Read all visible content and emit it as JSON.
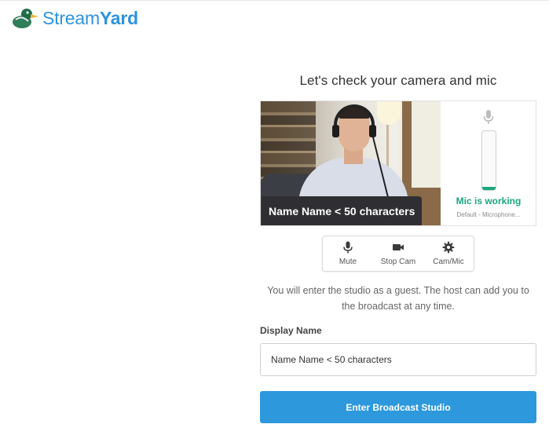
{
  "header": {
    "logo_text_a": "Stream",
    "logo_text_b": "Yard",
    "logo_icon": "duck-logo-icon",
    "brand_color": "#2e93dd"
  },
  "main": {
    "heading": "Let's check your camera and mic",
    "video": {
      "name_tag": "Name Name < 50 characters"
    },
    "mic": {
      "icon": "microphone-icon",
      "status": "Mic is working",
      "device": "Default - Microphone...",
      "level": 0.05,
      "status_color": "#1aa57f"
    },
    "controls": [
      {
        "label": "Mute",
        "icon": "microphone-icon"
      },
      {
        "label": "Stop Cam",
        "icon": "camera-icon"
      },
      {
        "label": "Cam/Mic",
        "icon": "gear-icon"
      }
    ],
    "guest_message": "You will enter the studio as a guest. The host can add you to the broadcast at any time.",
    "display_name_label": "Display Name",
    "display_name_value": "Name Name < 50 characters",
    "enter_button": "Enter Broadcast Studio",
    "button_color": "#2d98dc"
  }
}
